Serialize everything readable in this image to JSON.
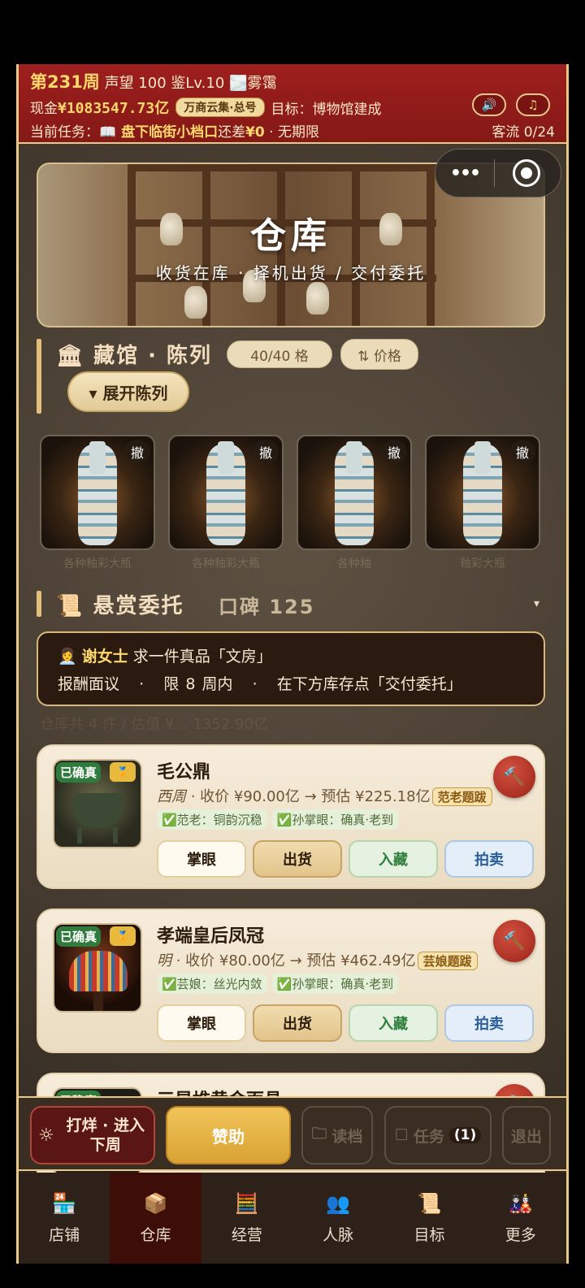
{
  "header": {
    "week": "第231周",
    "reputation": "声望 100",
    "level": "鉴Lv.10",
    "weather": "🌫️雾霭",
    "cash_label": "现金",
    "cash_value": "¥1083547.73亿",
    "title_badge": "万商云集·总号",
    "goal": "目标：博物馆建成",
    "task_label": "当前任务：",
    "task_name": "📖 盘下临街小档口",
    "task_diff": "还差",
    "task_diff_value": "¥0",
    "task_deadline": "· 无期限",
    "visitor_flow": "客流 0/24",
    "sound_icon": "speaker-icon",
    "music_icon": "music-note-icon"
  },
  "banner": {
    "title": "仓库",
    "subtitle": "收货在库 · 择机出货 / 交付委托"
  },
  "exhibit": {
    "title": "藏馆 · 陈列",
    "slots": "40/40 格",
    "sort": "⇅ 价格",
    "expand": "▾ 展开陈列",
    "remove_label": "撤",
    "captions": [
      "各种釉彩大瓶",
      "各种釉彩大瓶",
      "各种釉",
      "釉彩大瓶"
    ]
  },
  "bounty": {
    "title": "悬赏委托",
    "reputation": "口碑 125",
    "toggle": "▾",
    "requester": "谢女士",
    "request": "求一件真品「文房」",
    "reward": "报酬面议",
    "sep": "·",
    "limit": "限 8 周内",
    "instruction": "在下方库存点「交付委托」"
  },
  "inventory_summary": "仓库共 4 件 / 估值 ¥... 1352.90亿",
  "items": [
    {
      "badge": "已确真",
      "name": "毛公鼎",
      "era": "西周",
      "price": "· 收价 ¥90.00亿 → 预估 ¥225.18亿",
      "tag": "范老题跋",
      "notes": [
        "✅范老：铜韵沉稳",
        "✅孙掌眼：确真·老到"
      ],
      "buttons": [
        "掌眼",
        "出货",
        "入藏",
        "拍卖"
      ]
    },
    {
      "badge": "已确真",
      "name": "孝端皇后凤冠",
      "era": "明",
      "price": "· 收价 ¥80.00亿 → 预估 ¥462.49亿",
      "tag": "芸娘题跋",
      "notes": [
        "✅芸娘：丝光内敛",
        "✅孙掌眼：确真·老到"
      ],
      "buttons": [
        "掌眼",
        "出货",
        "入藏",
        "拍卖"
      ]
    },
    {
      "badge": "已确真",
      "name": "三星堆黄金面具"
    }
  ],
  "actions": {
    "next_week": "打烊 · 进入下周",
    "sponsor": "赞助",
    "load": "读档",
    "task": "任务",
    "task_count": "(1)",
    "exit": "退出"
  },
  "tabs": [
    "店铺",
    "仓库",
    "经营",
    "人脉",
    "目标",
    "更多"
  ],
  "colors": {
    "header_red": "#9e1f1e",
    "gold": "#e8c88b",
    "accent_yellow": "#ffd86d"
  }
}
